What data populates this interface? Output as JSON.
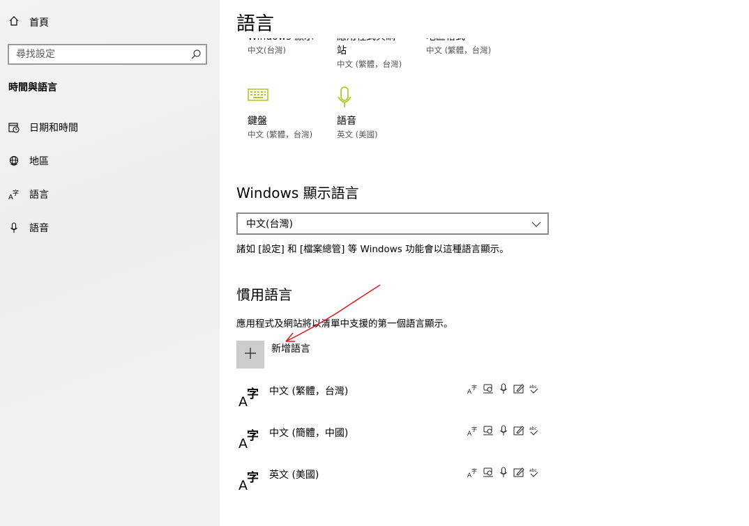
{
  "sidebar": {
    "home_label": "首頁",
    "search_placeholder": "尋找設定",
    "section_title": "時間與語言",
    "items": [
      {
        "label": "日期和時間",
        "icon": "calendar-clock-icon"
      },
      {
        "label": "地區",
        "icon": "globe-icon"
      },
      {
        "label": "語言",
        "icon": "language-icon"
      },
      {
        "label": "語音",
        "icon": "microphone-icon"
      }
    ]
  },
  "main": {
    "title": "語言",
    "tiles_partial": [
      {
        "label": "Windows 顯示",
        "sub": "中文(台灣)"
      },
      {
        "label": "應用程式與網\n站",
        "sub": "中文 (繁體，台灣)"
      },
      {
        "label": "地區格式",
        "sub": "中文 (繁體，台灣)"
      }
    ],
    "tiles": [
      {
        "label": "鍵盤",
        "sub": "中文 (繁體，台灣)",
        "icon": "keyboard-icon"
      },
      {
        "label": "語音",
        "sub": "英文 (美國)",
        "icon": "microphone-icon"
      }
    ],
    "display_language": {
      "heading": "Windows 顯示語言",
      "selected": "中文(台灣)",
      "description": "諸如 [設定] 和 [檔案總管] 等 Windows 功能會以這種語言顯示。"
    },
    "preferred": {
      "heading": "慣用語言",
      "description": "應用程式及網站將以清單中支援的第一個語言顯示。",
      "add_label": "新增語言",
      "languages": [
        {
          "name": "中文 (繁體，台灣)"
        },
        {
          "name": "中文 (簡體，中國)"
        },
        {
          "name": "英文 (美國)"
        }
      ],
      "capability_icons": [
        "display-language-icon",
        "text-to-speech-icon",
        "speech-recognition-icon",
        "handwriting-icon",
        "spell-check-icon"
      ]
    }
  },
  "colors": {
    "accent_icon": "#b4c72a",
    "sidebar_bg": "#f0f0f0",
    "add_button_bg": "#cccccc",
    "annotation_red": "#e0161c"
  }
}
